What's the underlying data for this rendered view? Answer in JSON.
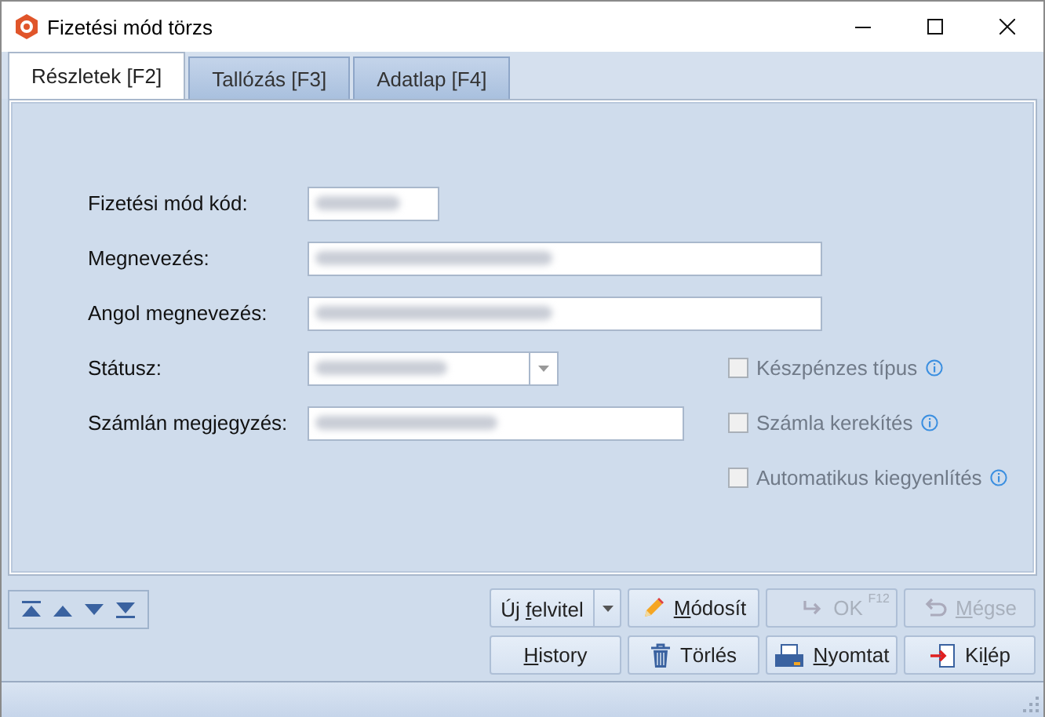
{
  "window": {
    "title": "Fizetési mód törzs"
  },
  "tabs": [
    {
      "label": "Részletek [F2]",
      "selected": true
    },
    {
      "label": "Tallózás [F3]",
      "selected": false
    },
    {
      "label": "Adatlap [F4]",
      "selected": false
    }
  ],
  "fields": [
    {
      "label": "Fizetési mód kód:",
      "kind": "text",
      "redacted": true
    },
    {
      "label": "Megnevezés:",
      "kind": "text",
      "redacted": true
    },
    {
      "label": "Angol megnevezés:",
      "kind": "text",
      "redacted": true
    },
    {
      "label": "Státusz:",
      "kind": "combo",
      "redacted": true
    },
    {
      "label": "Számlán megjegyzés:",
      "kind": "text",
      "redacted": true
    }
  ],
  "options": [
    {
      "label": "Készpénzes típus",
      "checked": false,
      "disabled": true
    },
    {
      "label": "Számla kerekítés",
      "checked": false,
      "disabled": true
    },
    {
      "label": "Automatikus kiegyenlítés",
      "checked": false,
      "disabled": true
    }
  ],
  "buttons": [
    {
      "label_parts": {
        "before": "Új ",
        "key": "f",
        "after": "elvitel"
      },
      "kind": "split",
      "disabled": false
    },
    {
      "label_parts": {
        "key": "M",
        "after": "ódosít"
      },
      "kind": "edit",
      "disabled": false
    },
    {
      "label": "OK",
      "kind": "ok",
      "shortcut": "F12",
      "disabled": true
    },
    {
      "label_parts": {
        "key": "M",
        "after": "égse"
      },
      "kind": "cancel",
      "disabled": true
    },
    {
      "label_parts": {
        "key": "H",
        "after": "istory"
      },
      "kind": "plain",
      "disabled": false
    },
    {
      "label": "Törlés",
      "kind": "delete",
      "disabled": false
    },
    {
      "label_parts": {
        "key": "N",
        "after": "yomtat"
      },
      "kind": "print",
      "disabled": false
    },
    {
      "label_parts": {
        "before": "Ki",
        "key": "l",
        "after": "ép"
      },
      "kind": "exit",
      "disabled": false
    }
  ]
}
